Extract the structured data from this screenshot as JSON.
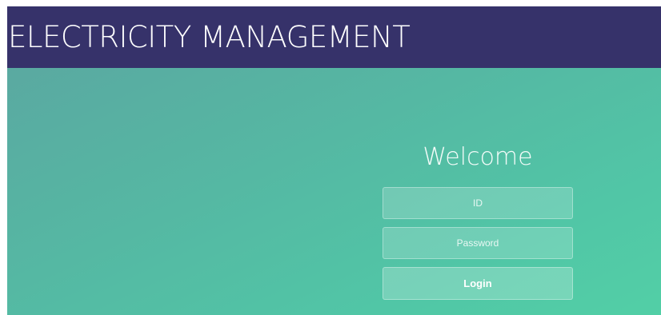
{
  "header": {
    "title": "ELECTRICITY MANAGEMENT"
  },
  "login": {
    "welcome": "Welcome",
    "id_placeholder": "ID",
    "id_value": "",
    "password_placeholder": "Password",
    "password_value": "",
    "button_label": "Login"
  },
  "colors": {
    "header_bg": "#36326a",
    "gradient_start": "#5aa9a1",
    "gradient_end": "#52cfa6"
  }
}
